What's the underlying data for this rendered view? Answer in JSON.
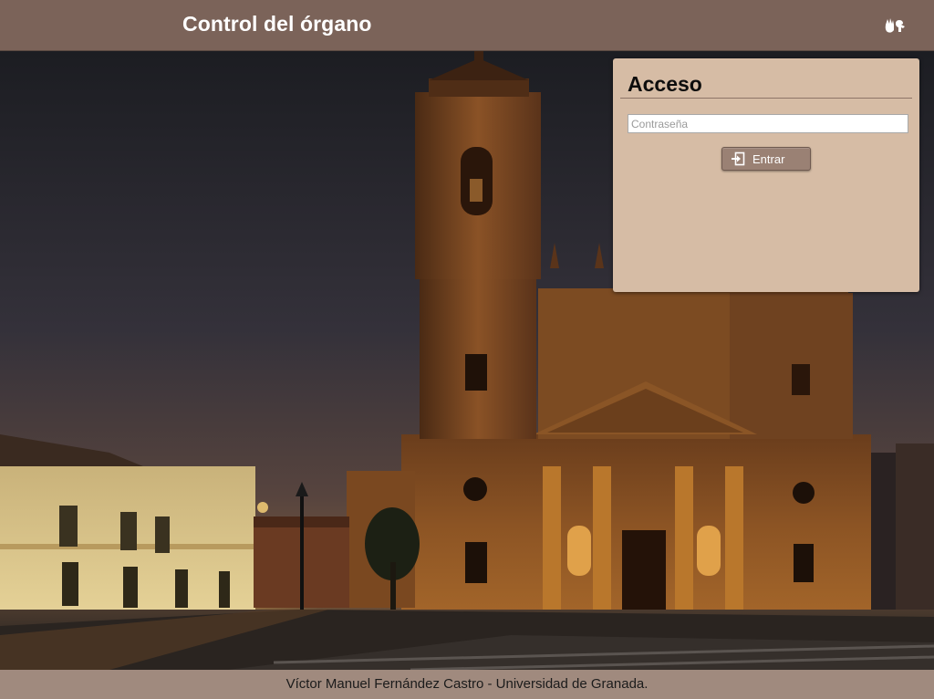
{
  "header": {
    "title": "Control del órgano",
    "icon": "sign-language-icon"
  },
  "login": {
    "title": "Acceso",
    "password_placeholder": "Contraseña",
    "password_value": "",
    "enter_label": "Entrar",
    "enter_icon": "sign-in-icon"
  },
  "footer": {
    "text": "Víctor Manuel Fernández Castro - Universidad de Granada."
  },
  "background": {
    "image": "cathedral-square-night-photo"
  },
  "colors": {
    "header_bg": "#7b6359",
    "footer_bg": "#a08a7e",
    "panel_bg": "#d6bca5",
    "button_bg": "#9a8174"
  }
}
